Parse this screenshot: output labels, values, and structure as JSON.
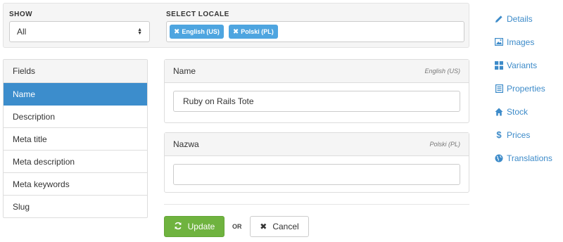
{
  "filters": {
    "show_label": "SHOW",
    "show_value": "All",
    "locale_label": "SELECT LOCALE",
    "locales": [
      "English (US)",
      "Polski (PL)"
    ]
  },
  "fields": {
    "header": "Fields",
    "items": [
      "Name",
      "Description",
      "Meta title",
      "Meta description",
      "Meta keywords",
      "Slug"
    ],
    "active": "Name"
  },
  "translations": [
    {
      "title": "Name",
      "locale": "English (US)",
      "value": "Ruby on Rails Tote"
    },
    {
      "title": "Nazwa",
      "locale": "Polski (PL)",
      "value": ""
    }
  ],
  "actions": {
    "update_label": "Update",
    "or_label": "OR",
    "cancel_label": "Cancel"
  },
  "sidebar": {
    "items": [
      {
        "label": "Details",
        "icon": "pencil-icon"
      },
      {
        "label": "Images",
        "icon": "image-icon"
      },
      {
        "label": "Variants",
        "icon": "grid-icon"
      },
      {
        "label": "Properties",
        "icon": "list-icon"
      },
      {
        "label": "Stock",
        "icon": "home-icon"
      },
      {
        "label": "Prices",
        "icon": "dollar-icon"
      },
      {
        "label": "Translations",
        "icon": "globe-icon"
      }
    ]
  },
  "colors": {
    "accent": "#3d8bc9",
    "active_field": "#3c8dcc",
    "chip": "#4ea5e0",
    "update_button": "#6fb33f"
  }
}
